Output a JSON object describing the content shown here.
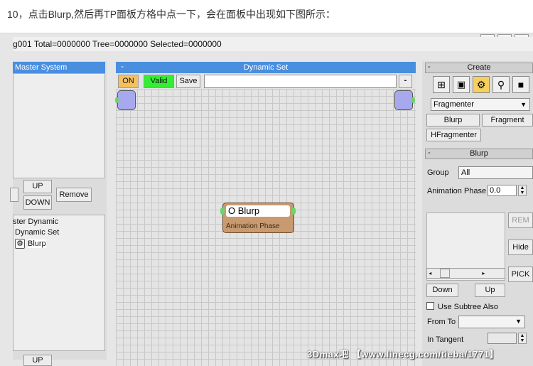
{
  "caption": "10，点击Blurp,然后再TP面板方格中点一下，会在面板中出现如下图所示：",
  "status": "g001 Total=0000000 Tree=0000000 Selected=0000000",
  "master": {
    "title": "Master System",
    "btn_up": "UP",
    "btn_down": "DOWN",
    "btn_remove": "Remove",
    "tree": [
      "ster Dynamic",
      "Dynamic Set",
      "Blurp"
    ],
    "btn_up2": "UP"
  },
  "dynset": {
    "title": "Dynamic Set",
    "collapse": "-",
    "btn_on": "ON",
    "btn_valid": "Valid",
    "btn_save": "Save",
    "minus": "-"
  },
  "node": {
    "title": "O Blurp",
    "subtitle": "Animation Phase"
  },
  "create": {
    "title": "Create",
    "collapse": "-",
    "dropdown": "Fragmenter",
    "btn_blurp": "Blurp",
    "btn_fragment": "Fragment",
    "btn_hfragmenter": "HFragmenter"
  },
  "blurp": {
    "title": "Blurp",
    "collapse": "-",
    "group_label": "Group",
    "group_value": "All",
    "phase_label": "Animation Phase",
    "phase_value": "0.0",
    "btn_rem": "REM",
    "btn_hide": "Hide",
    "btn_pick": "PICK",
    "btn_down": "Down",
    "btn_up": "Up",
    "subtree": "Use Subtree Also",
    "fromto": "From To",
    "intangent": "In Tangent"
  },
  "watermark": "3Dmax吧 【www.linecg.com/tieba/1771】",
  "colors": {
    "title_blue": "#4a8ee0",
    "on_orange": "#f4c060",
    "valid_green": "#33ee33",
    "node_brown": "#c89a70",
    "port_purple": "#a8a8ee"
  }
}
